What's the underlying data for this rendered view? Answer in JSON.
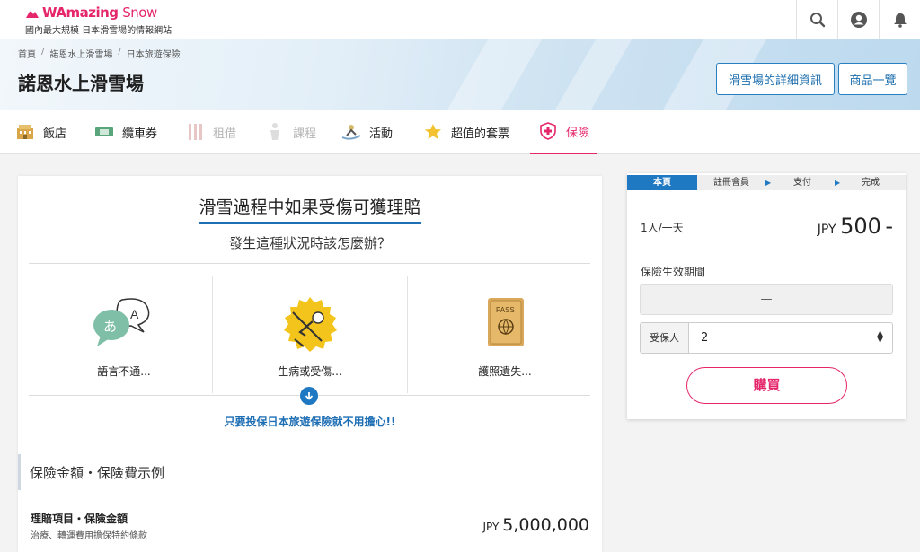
{
  "brand": {
    "logo_main": "WAmazing",
    "logo_sub": "Snow",
    "tagline": "國內最大規模 日本滑雪場的情報網站",
    "accent": "#e5266b"
  },
  "header_icons": [
    "search-icon",
    "user-icon",
    "bell-icon"
  ],
  "breadcrumb": [
    "首頁",
    "諾恩水上滑雪場",
    "日本旅遊保險"
  ],
  "resort_title": "諾恩水上滑雪場",
  "hero_buttons": {
    "details": "滑雪場的詳細資訊",
    "products": "商品一覽"
  },
  "tabs": [
    {
      "label": "飯店",
      "icon": "hotel-icon",
      "state": "normal"
    },
    {
      "label": "纜車券",
      "icon": "lift-ticket-icon",
      "state": "normal"
    },
    {
      "label": "租借",
      "icon": "rental-icon",
      "state": "disabled"
    },
    {
      "label": "課程",
      "icon": "lesson-icon",
      "state": "disabled"
    },
    {
      "label": "活動",
      "icon": "activity-icon",
      "state": "normal"
    },
    {
      "label": "超值的套票",
      "icon": "star-icon",
      "state": "normal"
    },
    {
      "label": "保險",
      "icon": "insurance-icon",
      "state": "active"
    }
  ],
  "main": {
    "headline": "滑雪過程中如果受傷可獲理賠",
    "subheadline": "發生這種狀況時該怎麼辦？",
    "scenarios": [
      {
        "label": "語言不通...",
        "icon": "language-bubble-icon"
      },
      {
        "label": "生病或受傷...",
        "icon": "injured-skier-icon"
      },
      {
        "label": "護照遺失...",
        "icon": "passport-icon"
      }
    ],
    "reassure": "只要投保日本旅遊保險就不用擔心!!",
    "section_title": "保險金額・保險費示例",
    "coverage": {
      "label": "理賠項目・保險金額",
      "sub": "治療、轉運費用擔保特約條款",
      "currency": "JPY",
      "amount": "5,000,000"
    }
  },
  "side": {
    "steps": [
      "本頁",
      "註冊會員",
      "支付",
      "完成"
    ],
    "per_unit": "1人/一天",
    "price_currency": "JPY",
    "price_value": "500",
    "price_suffix": "-",
    "period_label": "保險生效期間",
    "period_value": "—",
    "select_label": "受保人",
    "select_value": "2",
    "buy_label": "購買"
  }
}
